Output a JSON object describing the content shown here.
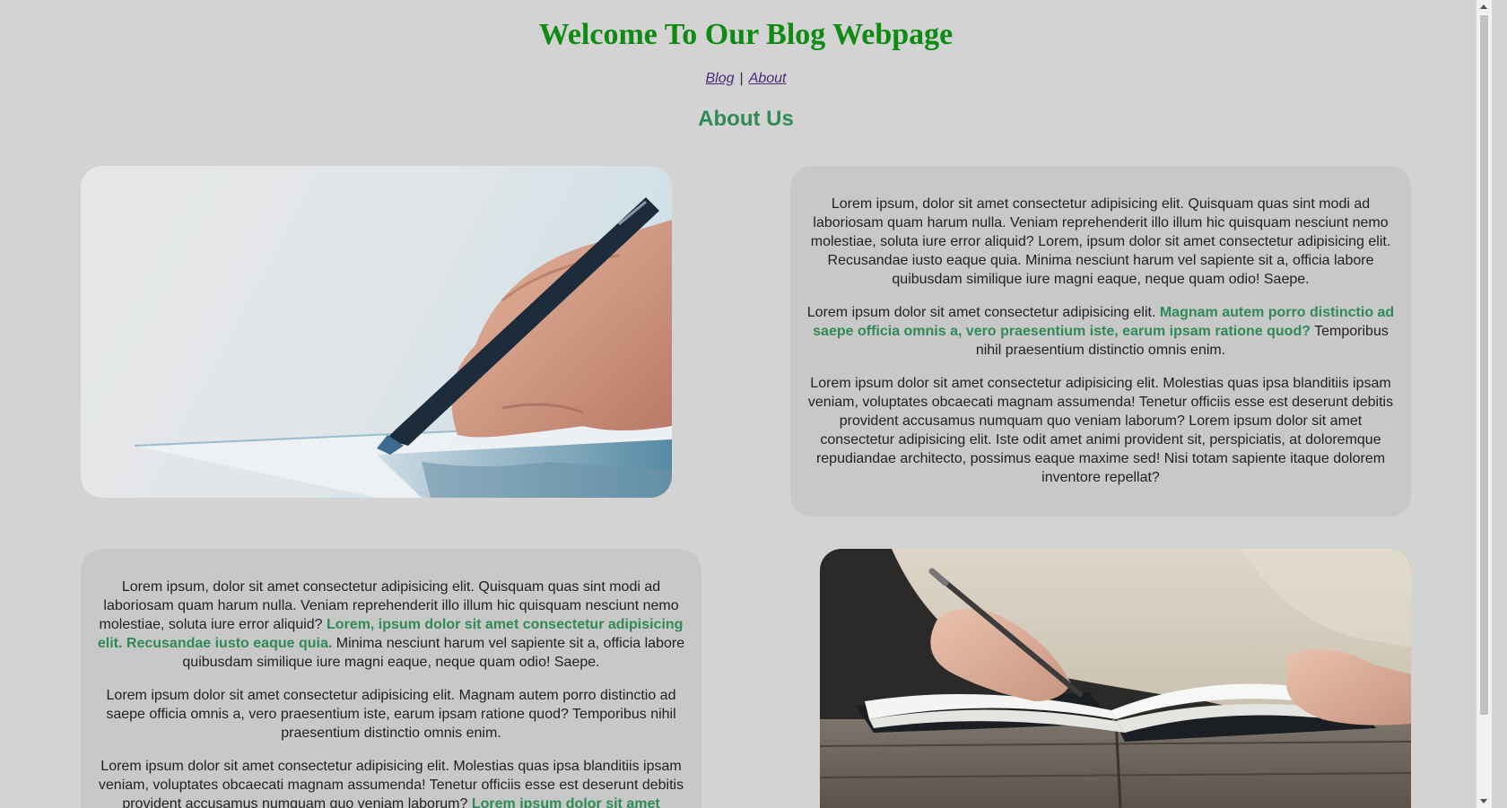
{
  "header": {
    "title": "Welcome To Our Blog Webpage",
    "nav": {
      "blog_label": "Blog",
      "separator": "|",
      "about_label": "About"
    },
    "section_title": "About Us"
  },
  "colors": {
    "page_background": "#d3d3d3",
    "card_background": "#c8c8c8",
    "title_color": "#0f8a12",
    "accent_green": "#2e8b57",
    "link_color": "#4b2a7a"
  },
  "images": {
    "first": "pen-writing-photo",
    "second": "notebook-writing-photo"
  },
  "card_right": {
    "p1": "Lorem ipsum, dolor sit amet consectetur adipisicing elit. Quisquam quas sint modi ad laboriosam quam harum nulla. Veniam reprehenderit illo illum hic quisquam nesciunt nemo molestiae, soluta iure error aliquid? Lorem, ipsum dolor sit amet consectetur adipisicing elit. Recusandae iusto eaque quia. Minima nesciunt harum vel sapiente sit a, officia labore quibusdam similique iure magni eaque, neque quam odio! Saepe.",
    "p2_before": "Lorem ipsum dolor sit amet consectetur adipisicing elit. ",
    "p2_highlight": "Magnam autem porro distinctio ad saepe officia omnis a, vero praesentium iste, earum ipsam ratione quod?",
    "p2_after": " Temporibus nihil praesentium distinctio omnis enim.",
    "p3": "Lorem ipsum dolor sit amet consectetur adipisicing elit. Molestias quas ipsa blanditiis ipsam veniam, voluptates obcaecati magnam assumenda! Tenetur officiis esse est deserunt debitis provident accusamus numquam quo veniam laborum? Lorem ipsum dolor sit amet consectetur adipisicing elit. Iste odit amet animi provident sit, perspiciatis, at doloremque repudiandae architecto, possimus eaque maxime sed! Nisi totam sapiente itaque dolorem inventore repellat?"
  },
  "card_left": {
    "p1_before": "Lorem ipsum, dolor sit amet consectetur adipisicing elit. Quisquam quas sint modi ad laboriosam quam harum nulla. Veniam reprehenderit illo illum hic quisquam nesciunt nemo molestiae, soluta iure error aliquid? ",
    "p1_highlight": "Lorem, ipsum dolor sit amet consectetur adipisicing elit. Recusandae iusto eaque quia.",
    "p1_after": " Minima nesciunt harum vel sapiente sit a, officia labore quibusdam similique iure magni eaque, neque quam odio! Saepe.",
    "p2": "Lorem ipsum dolor sit amet consectetur adipisicing elit. Magnam autem porro distinctio ad saepe officia omnis a, vero praesentium iste, earum ipsam ratione quod? Temporibus nihil praesentium distinctio omnis enim.",
    "p3_before": "Lorem ipsum dolor sit amet consectetur adipisicing elit. Molestias quas ipsa blanditiis ipsam veniam, voluptates obcaecati magnam assumenda! Tenetur officiis esse est deserunt debitis provident accusamus numquam quo veniam laborum? ",
    "p3_highlight": "Lorem ipsum dolor sit amet"
  }
}
